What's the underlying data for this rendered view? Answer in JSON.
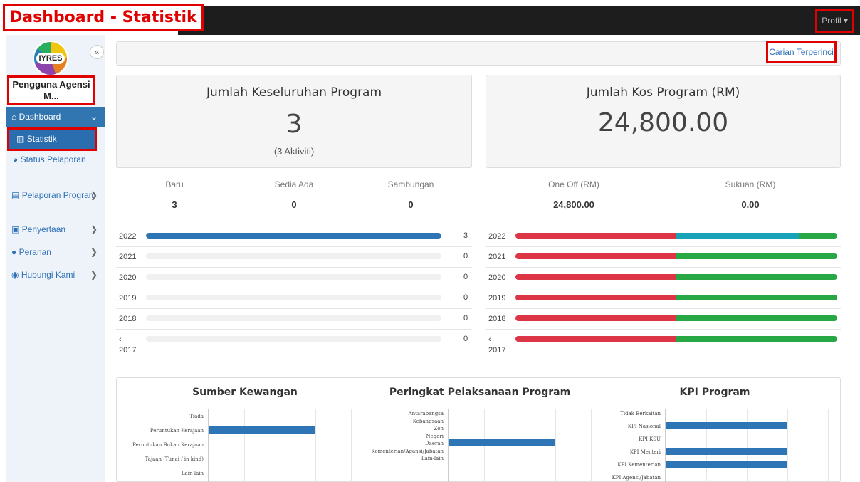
{
  "header": {
    "title": "Dashboard - Statistik",
    "profil": "Profil ▾"
  },
  "sidebar": {
    "logo_text": "IYRES",
    "collapse": "«",
    "user": "Pengguna Agensi M...",
    "items": [
      {
        "label": "Dashboard",
        "icon": "home-icon",
        "chevron": "❯"
      },
      {
        "label": "Statistik",
        "icon": "chart-icon"
      },
      {
        "label": "Status Pelaporan",
        "icon": "pie-icon"
      },
      {
        "label": "Pelaporan Program",
        "icon": "book-icon",
        "chevron": "❯"
      },
      {
        "label": "Penyertaan",
        "icon": "clipboard-icon",
        "chevron": "❯"
      },
      {
        "label": "Peranan",
        "icon": "user-icon",
        "chevron": "❯"
      },
      {
        "label": "Hubungi Kami",
        "icon": "chat-icon",
        "chevron": "❯"
      }
    ]
  },
  "search": {
    "advanced_link": "Carian Terperinci"
  },
  "program_card": {
    "title": "Jumlah Keseluruhan Program",
    "value": "3",
    "sub": "(3 Aktiviti)"
  },
  "cost_card": {
    "title": "Jumlah Kos Program (RM)",
    "value": "24,800.00"
  },
  "program_stats": [
    {
      "label": "Baru",
      "value": "3"
    },
    {
      "label": "Sedia Ada",
      "value": "0"
    },
    {
      "label": "Sambungan",
      "value": "0"
    }
  ],
  "cost_stats": [
    {
      "label": "One Off (RM)",
      "value": "24,800.00"
    },
    {
      "label": "Sukuan (RM)",
      "value": "0.00"
    }
  ],
  "program_years": [
    {
      "year": "2022",
      "count": "3",
      "fraction": 1.0
    },
    {
      "year": "2021",
      "count": "0",
      "fraction": 0
    },
    {
      "year": "2020",
      "count": "0",
      "fraction": 0
    },
    {
      "year": "2019",
      "count": "0",
      "fraction": 0
    },
    {
      "year": "2018",
      "count": "0",
      "fraction": 0
    },
    {
      "year": "‹\n2017",
      "count": "0",
      "fraction": 0
    }
  ],
  "cost_years": [
    {
      "year": "2022",
      "segments": [
        0.5,
        0.38,
        0.12
      ]
    },
    {
      "year": "2021",
      "segments": [
        0.5,
        0,
        0.5
      ]
    },
    {
      "year": "2020",
      "segments": [
        0.5,
        0,
        0.5
      ]
    },
    {
      "year": "2019",
      "segments": [
        0.5,
        0,
        0.5
      ]
    },
    {
      "year": "2018",
      "segments": [
        0.5,
        0,
        0.5
      ]
    },
    {
      "year": "‹\n2017",
      "segments": [
        0.5,
        0,
        0.5
      ]
    }
  ],
  "colors": {
    "blue": "#2e75b6",
    "red": "#dc3545",
    "teal": "#17a2b8",
    "green": "#28a745"
  },
  "bottom_charts": [
    {
      "title": "Sumber Kewangan",
      "labels": [
        "Tiada",
        "Peruntukan Kerajaan",
        "Peruntukan Bukan Kerajaan",
        "Tajaan (Tunai / in kind)",
        "Lain-lain"
      ],
      "values": [
        0,
        3,
        0,
        0,
        0
      ],
      "max": 4
    },
    {
      "title": "Peringkat Pelaksanaan Program",
      "labels": [
        "Antarabangsa",
        "Kebangsaan",
        "Zon",
        "Negeri",
        "Daerah",
        "Kementerian/Agansi/Jabatan",
        "Lain-lain"
      ],
      "values": [
        0,
        0,
        0,
        0,
        3,
        0,
        0
      ],
      "max": 4
    },
    {
      "title": "KPI Program",
      "labels": [
        "Tidak Berkaitan",
        "KPI Nasional",
        "KPI KSU",
        "KPI Menteri",
        "KPI Kementerian",
        "KPI Agensi/Jabatan"
      ],
      "values": [
        0,
        3,
        0,
        3,
        3,
        0
      ],
      "max": 4
    }
  ]
}
